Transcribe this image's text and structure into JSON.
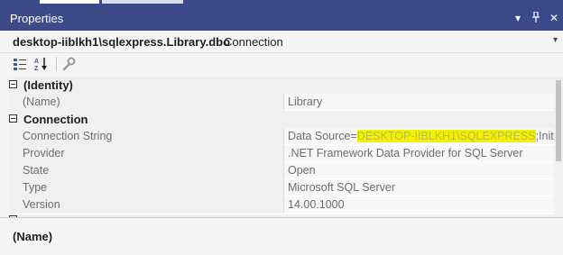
{
  "window": {
    "title": "Properties"
  },
  "object_selector": {
    "name": "desktop-iiblkh1\\sqlexpress.Library.dbo",
    "type": "Connection"
  },
  "toolbar": {
    "icons": [
      "categorized-icon",
      "alphabetical-icon",
      "property-pages-icon"
    ]
  },
  "grid": {
    "categories": [
      {
        "label": "(Identity)",
        "properties": [
          {
            "name": "(Name)",
            "value": "Library"
          }
        ]
      },
      {
        "label": "Connection",
        "properties": [
          {
            "name": "Connection String",
            "value_prefix": "Data Source=",
            "value_highlighted": "DESKTOP-IIBLKH1\\SQLEXPRESS",
            "value_suffix": ";Initial Ca"
          },
          {
            "name": "Provider",
            "value": ".NET Framework Data Provider for SQL Server"
          },
          {
            "name": "State",
            "value": "Open"
          },
          {
            "name": "Type",
            "value": "Microsoft SQL Server"
          },
          {
            "name": "Version",
            "value": "14.00.1000"
          }
        ]
      }
    ]
  },
  "description": {
    "title": "(Name)"
  },
  "colors": {
    "titlebar": "#3c4a8a",
    "highlight": "#f2f200"
  }
}
